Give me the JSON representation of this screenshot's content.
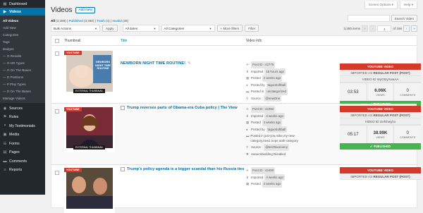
{
  "sidebar": {
    "items": [
      {
        "icon": "dashboard-icon",
        "glyph": "▦",
        "label": "Dashboard"
      },
      {
        "icon": "videos-icon",
        "glyph": "▶",
        "label": "Videos",
        "active": true
      }
    ],
    "sub": [
      "All Videos",
      "Add New",
      "Categories",
      "Tags",
      "Badges",
      "— O Results",
      "— O HR Types",
      "— O On The Bases",
      "— D Positions",
      "— P Play Types",
      "— D On The Bases",
      "Manage Videos"
    ],
    "bottom": [
      {
        "icon": "sources-icon",
        "glyph": "◉",
        "label": "Sources"
      },
      {
        "icon": "rules-icon",
        "glyph": "⚑",
        "label": "Rules"
      },
      {
        "icon": "testimonials-icon",
        "glyph": "❝",
        "label": "My Testimonials"
      },
      {
        "icon": "media-icon",
        "glyph": "▣",
        "label": "Media"
      },
      {
        "icon": "forms-icon",
        "glyph": "☰",
        "label": "Forms"
      },
      {
        "icon": "pages-icon",
        "glyph": "▤",
        "label": "Pages"
      },
      {
        "icon": "comments-icon",
        "glyph": "▬",
        "label": "Comments"
      },
      {
        "icon": "reports-icon",
        "glyph": "≡",
        "label": "Reports"
      }
    ]
  },
  "topbar": {
    "screen_options": "Screen Options ▾",
    "help": "Help ▾"
  },
  "header": {
    "title": "Videos",
    "add_new": "Add New"
  },
  "search": {
    "placeholder": "",
    "button": "Search Video"
  },
  "views": {
    "all": "All",
    "all_count": "(3,389)",
    "published": "Published",
    "published_count": "(3,360)",
    "trash": "Trash",
    "trash_count": "(4)",
    "invalid": "Invalid",
    "invalid_count": "(28)"
  },
  "filters": {
    "bulk_actions": "Bulk Actions",
    "apply": "Apply",
    "dates": "All dates",
    "categories": "All Categories",
    "more_filters": "+ More filters",
    "filter": "Filter"
  },
  "pagination": {
    "items": "3,360 items",
    "first": "«",
    "prev": "‹",
    "page": "1",
    "of": "of 168",
    "next": "›",
    "last": "»"
  },
  "columns": {
    "thumbnail": "Thumbnail",
    "title": "Title",
    "info": "Video Info"
  },
  "badges": {
    "youtube": "YOUTUBE",
    "external": "EXTERNAL THUMBNAIL",
    "thumb_text": "NEWBORN NIGHT TIME ROUTINE"
  },
  "rows": [
    {
      "title": "NEWBORN NIGHT TIME ROUTINE!",
      "post_id": "Post ID : 42778",
      "imported": "15 hours ago",
      "posted": "2 weeks ago",
      "posted_by": "taguoSoftball",
      "posted_in": "uncategorized",
      "source": "@newOne",
      "autoembed": "Autoembedding Disabled",
      "video_type": "YOUTUBE VIDEO",
      "imported_as": "REGULAR POST (POST)",
      "video_id": "WyOt2yXwaAA",
      "duration": "03:53",
      "views": "6.06K",
      "comments": "0",
      "status": "PUBLISHED"
    },
    {
      "title": "Trump reverses parts of Obama-era Cuba policy | The View",
      "post_id": "Post ID : 42492",
      "imported": "4 weeks ago",
      "posted": "4 weeks ago",
      "posted_by": "taguoSoftball",
      "posted_in": "just-you,mike,my-new-category,new1,nope,utah-category",
      "source": "@testTaxonomy",
      "autoembed": "Autoembedding Disabled",
      "video_type": "YOUTUBE VIDEO",
      "imported_as": "REGULAR POST (POST)",
      "video_id": "1tnhihwyho",
      "duration": "05:17",
      "views": "38.99K",
      "comments": "0",
      "status": "PUBLISHED"
    },
    {
      "title": "Trump's policy agenda is a bigger scandal than his Russia ties",
      "post_id": "Post ID : 42490",
      "imported": "4 weeks ago",
      "posted": "4 weeks ago",
      "video_type": "YOUTUBE VIDEO",
      "imported_as": "REGULAR POST (POST)"
    }
  ],
  "labels": {
    "imported_as": "IMPORTED AS",
    "video_id": "VIDEO ID",
    "views": "VIEWS",
    "comments": "COMMENTS",
    "imported": "Imported",
    "posted": "Posted",
    "posted_by": "Posted by",
    "posted_in": "Posted in",
    "source": "Source :"
  },
  "colors": {
    "accent": "#0073aa",
    "sidebar": "#23282d",
    "youtube_red": "#d33a2c",
    "published_green": "#46b450"
  }
}
